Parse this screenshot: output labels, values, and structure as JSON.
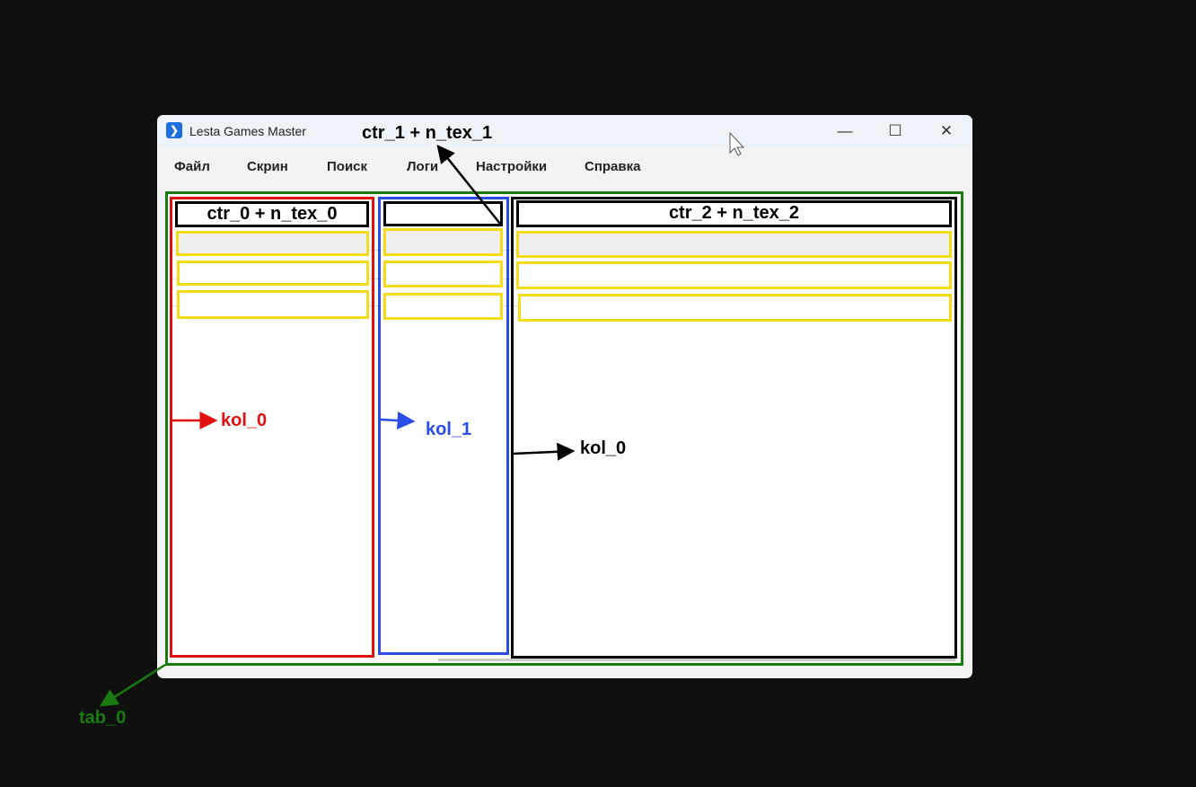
{
  "window": {
    "title": "Lesta Games Master",
    "controls": [
      "minimize",
      "maximize",
      "close"
    ]
  },
  "menu": [
    "Файл",
    "Скрин",
    "Поиск",
    "Логи",
    "Настройки",
    "Справка"
  ],
  "annotations": {
    "ctr_1": "ctr_1 + n_tex_1",
    "ctr_0": "ctr_0 + n_tex_0",
    "ctr_2": "ctr_2 + n_tex_2",
    "kol_0_left": "kol_0",
    "kol_1": "kol_1",
    "kol_0_right": "kol_0",
    "tab_0": "tab_0"
  },
  "colors": {
    "tab": "#1a7a10",
    "col0": "#e01010",
    "col1": "#2a4de8",
    "col2": "#000000",
    "rows": "#f5dc1a"
  }
}
